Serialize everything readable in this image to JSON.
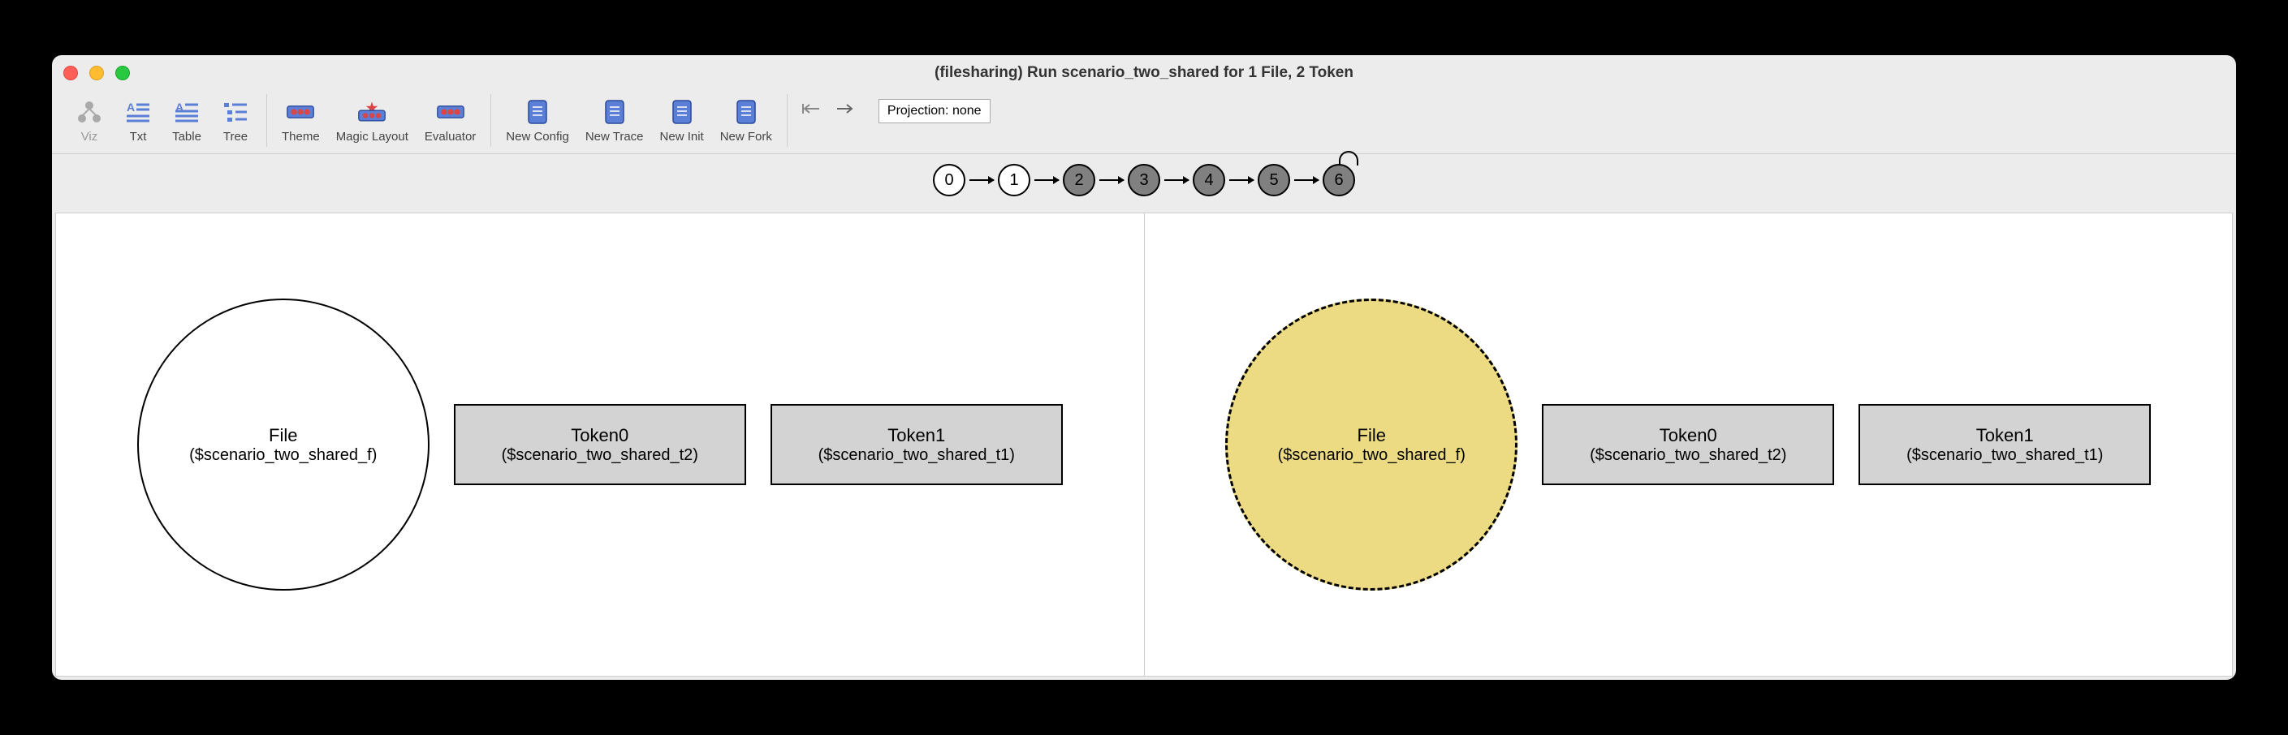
{
  "window": {
    "title": "(filesharing) Run scenario_two_shared for 1 File, 2 Token"
  },
  "toolbar": {
    "viz": "Viz",
    "txt": "Txt",
    "table": "Table",
    "tree": "Tree",
    "theme": "Theme",
    "magic_layout": "Magic Layout",
    "evaluator": "Evaluator",
    "new_config": "New Config",
    "new_trace": "New Trace",
    "new_init": "New Init",
    "new_fork": "New Fork",
    "projection": "Projection: none"
  },
  "states": {
    "nodes": [
      "0",
      "1",
      "2",
      "3",
      "4",
      "5",
      "6"
    ],
    "current": 1,
    "loop_at": 6
  },
  "panes": {
    "left": {
      "file": {
        "label": "File",
        "sub": "($scenario_two_shared_f)"
      },
      "token0": {
        "label": "Token0",
        "sub": "($scenario_two_shared_t2)"
      },
      "token1": {
        "label": "Token1",
        "sub": "($scenario_two_shared_t1)"
      }
    },
    "right": {
      "file": {
        "label": "File",
        "sub": "($scenario_two_shared_f)"
      },
      "token0": {
        "label": "Token0",
        "sub": "($scenario_two_shared_t2)"
      },
      "token1": {
        "label": "Token1",
        "sub": "($scenario_two_shared_t1)"
      }
    }
  }
}
